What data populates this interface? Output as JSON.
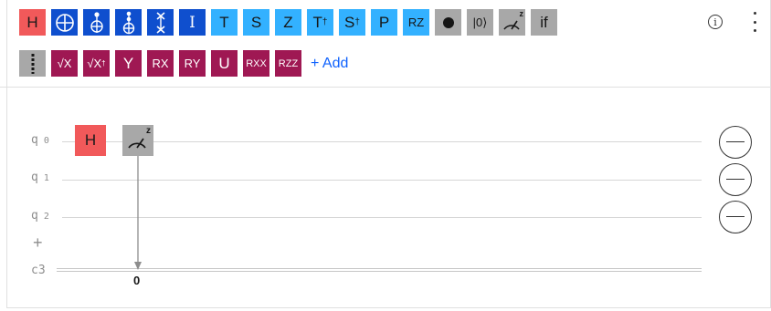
{
  "palette": {
    "row1": {
      "h": "H",
      "identity": "I",
      "t": "T",
      "s": "S",
      "z": "Z",
      "tdg": "T",
      "tdg_sup": "†",
      "sdg": "S",
      "sdg_sup": "†",
      "p": "P",
      "rz": "RZ",
      "reset": "|0⟩",
      "measure_sup": "z",
      "if": "if"
    },
    "row2": {
      "sx": "√X",
      "sxdg": "√X",
      "sxdg_sup": "†",
      "y": "Y",
      "rx": "RX",
      "ry": "RY",
      "u": "U",
      "rxx": "RXX",
      "rzz": "RZZ",
      "add": "+ Add"
    },
    "info_glyph": "i"
  },
  "circuit": {
    "qubits": [
      {
        "name": "q",
        "index": "0"
      },
      {
        "name": "q",
        "index": "1"
      },
      {
        "name": "q",
        "index": "2"
      }
    ],
    "add_qubit": "+",
    "classical": {
      "name": "c3"
    },
    "placed_gates": {
      "h_label": "H",
      "measure_sup": "z",
      "measure_bit": "0"
    }
  },
  "colors": {
    "h_gate": "#f1595a",
    "classic_gate": "#0f4fce",
    "phase_gate": "#33b1ff",
    "non_unitary": "#a8a8a8",
    "rotation_gate": "#9f1853",
    "link": "#0f62fe"
  }
}
